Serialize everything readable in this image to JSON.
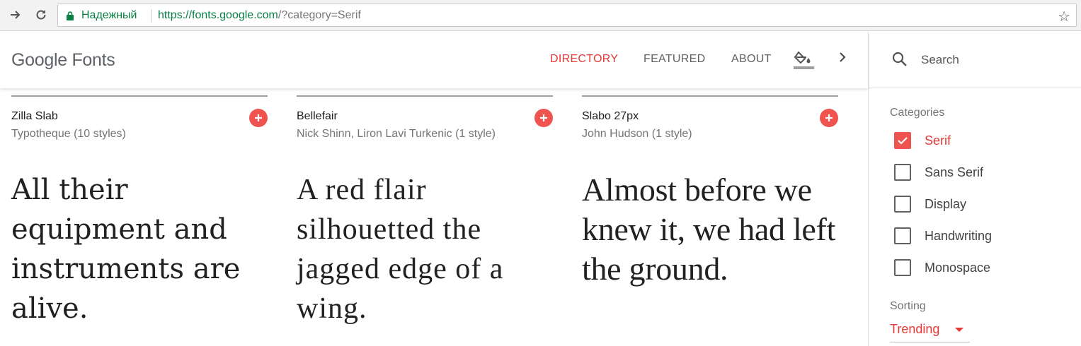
{
  "browser": {
    "secure_label": "Надежный",
    "url_host": "https://fonts.google.com",
    "url_path": "/?category=Serif"
  },
  "header": {
    "logo": "Google Fonts",
    "nav": [
      {
        "label": "DIRECTORY",
        "active": true
      },
      {
        "label": "FEATURED",
        "active": false
      },
      {
        "label": "ABOUT",
        "active": false
      }
    ]
  },
  "search": {
    "placeholder": "Search"
  },
  "sidebar": {
    "categories_label": "Categories",
    "categories": [
      {
        "label": "Serif",
        "checked": true
      },
      {
        "label": "Sans Serif",
        "checked": false
      },
      {
        "label": "Display",
        "checked": false
      },
      {
        "label": "Handwriting",
        "checked": false
      },
      {
        "label": "Monospace",
        "checked": false
      }
    ],
    "sorting_label": "Sorting",
    "sorting_value": "Trending"
  },
  "fonts": [
    {
      "name": "Zilla Slab",
      "author": "Typotheque (10 styles)",
      "sample": "All their equipment and instruments are alive."
    },
    {
      "name": "Bellefair",
      "author": "Nick Shinn, Liron Lavi Turkenic (1 style)",
      "sample": "A red flair silhouetted the jagged edge of a wing."
    },
    {
      "name": "Slabo 27px",
      "author": "John Hudson (1 style)",
      "sample": "Almost before we knew it, we had left the ground."
    }
  ],
  "colors": {
    "accent": "#ef5350",
    "secure": "#0b8043"
  }
}
